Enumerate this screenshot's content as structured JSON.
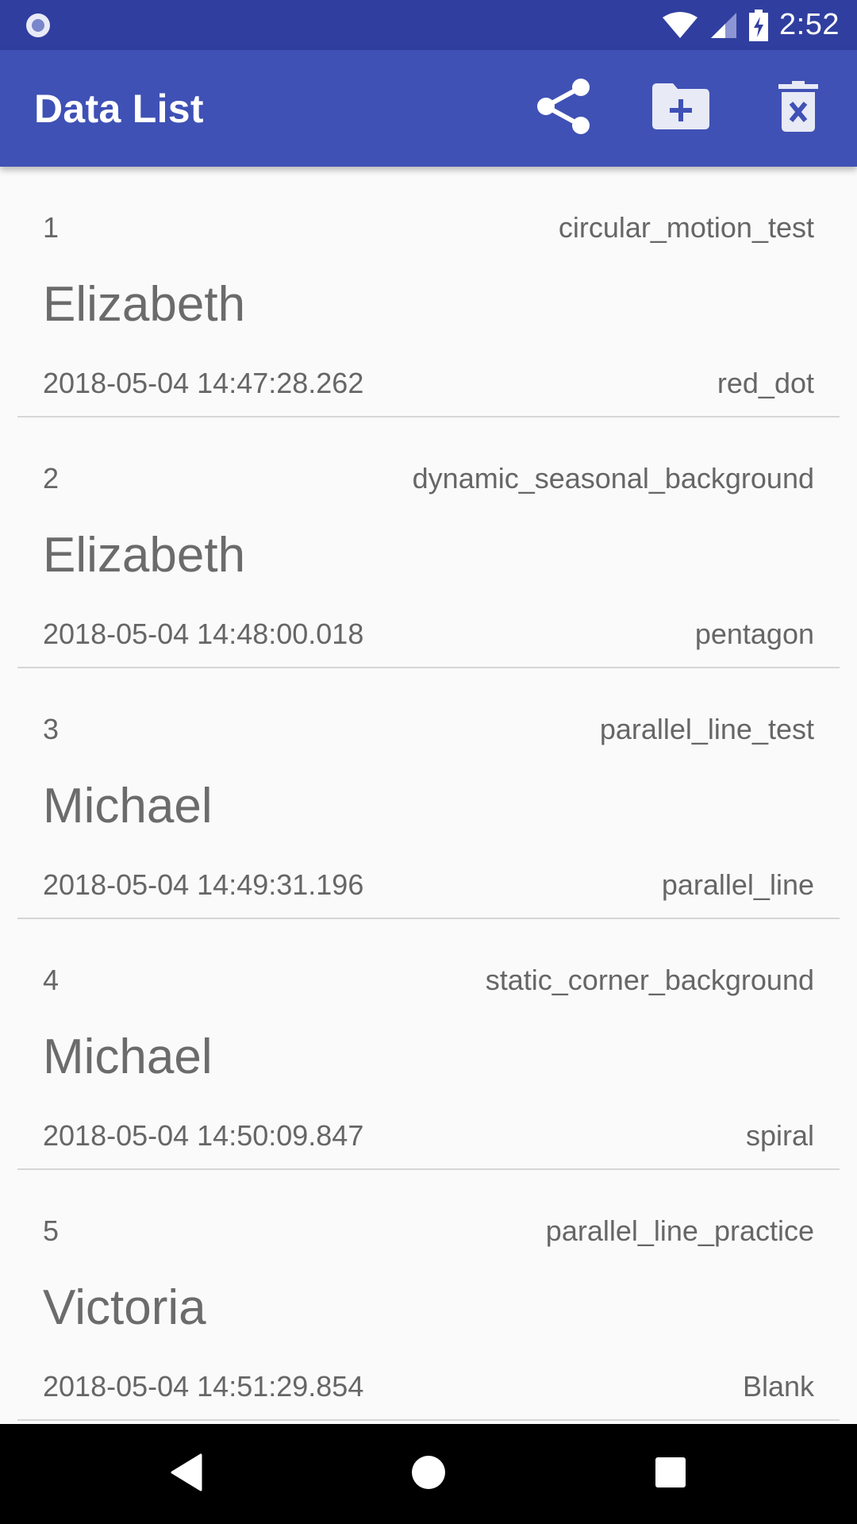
{
  "status_bar": {
    "time": "2:52",
    "icons": [
      "app-notification-icon",
      "wifi-icon",
      "cell-signal-icon",
      "battery-charging-icon"
    ]
  },
  "app_bar": {
    "title": "Data List",
    "actions": [
      {
        "icon": "share-icon"
      },
      {
        "icon": "folder-add-icon"
      },
      {
        "icon": "delete-icon"
      }
    ]
  },
  "items": [
    {
      "number": "1",
      "test": "circular_motion_test",
      "name": "Elizabeth",
      "timestamp": "2018-05-04 14:47:28.262",
      "shape": "red_dot"
    },
    {
      "number": "2",
      "test": "dynamic_seasonal_background",
      "name": "Elizabeth",
      "timestamp": "2018-05-04 14:48:00.018",
      "shape": "pentagon"
    },
    {
      "number": "3",
      "test": "parallel_line_test",
      "name": "Michael",
      "timestamp": "2018-05-04 14:49:31.196",
      "shape": "parallel_line"
    },
    {
      "number": "4",
      "test": "static_corner_background",
      "name": "Michael",
      "timestamp": "2018-05-04 14:50:09.847",
      "shape": "spiral"
    },
    {
      "number": "5",
      "test": "parallel_line_practice",
      "name": "Victoria",
      "timestamp": "2018-05-04 14:51:29.854",
      "shape": "Blank"
    }
  ],
  "nav_bar": {
    "buttons": [
      "back-icon",
      "home-icon",
      "recents-icon"
    ]
  },
  "colors": {
    "status_bar": "#303f9f",
    "app_bar": "#3f51b5",
    "background": "#fafafa",
    "nav_bar": "#000000"
  }
}
